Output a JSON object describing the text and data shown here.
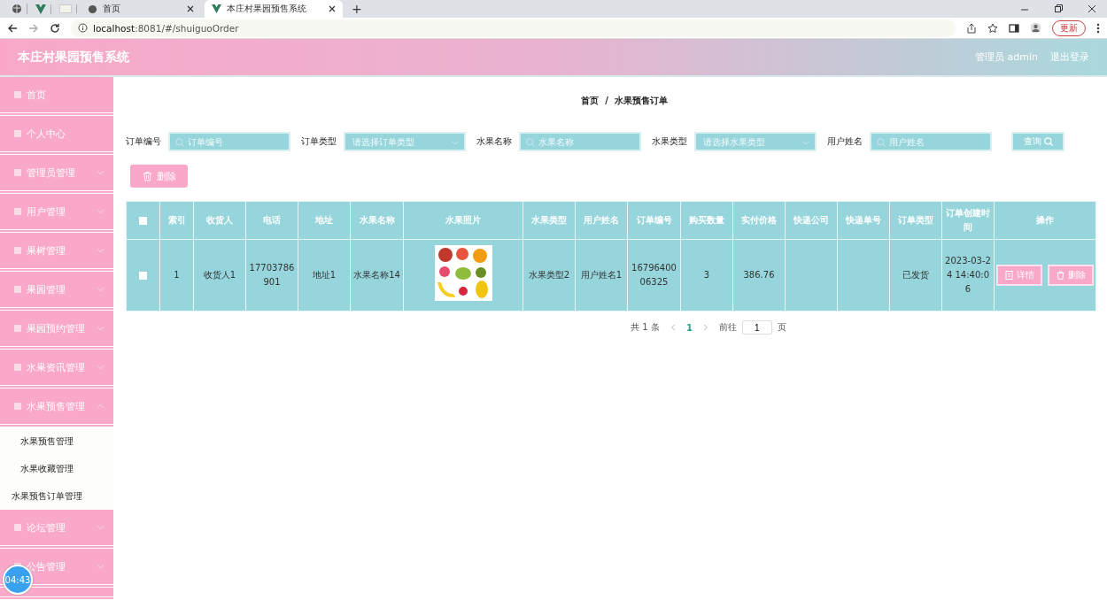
{
  "browser": {
    "tabs": [
      {
        "title": "首页",
        "selected": false
      },
      {
        "title": "本庄村果园预售系统",
        "selected": true
      }
    ],
    "new_tab": "+",
    "url_host": "localhost",
    "url_rest": ":8081/#/shuiguoOrder",
    "update_button": "更新"
  },
  "header": {
    "title": "本庄村果园预售系统",
    "user": "管理员 admin",
    "logout": "退出登录"
  },
  "sidebar": {
    "items": [
      {
        "label": "首页",
        "kind": "link"
      },
      {
        "label": "个人中心",
        "kind": "link"
      },
      {
        "label": "管理员管理",
        "kind": "menu",
        "expanded": false
      },
      {
        "label": "用户管理",
        "kind": "menu",
        "expanded": false
      },
      {
        "label": "果树管理",
        "kind": "menu",
        "expanded": false
      },
      {
        "label": "果园管理",
        "kind": "menu",
        "expanded": false
      },
      {
        "label": "果园预约管理",
        "kind": "menu",
        "expanded": false
      },
      {
        "label": "水果资讯管理",
        "kind": "menu",
        "expanded": false
      },
      {
        "label": "水果预售管理",
        "kind": "menu",
        "expanded": true,
        "children": [
          {
            "label": "水果预售管理",
            "kind": "sub"
          },
          {
            "label": "水果收藏管理",
            "kind": "sub"
          },
          {
            "label": "水果预售订单管理",
            "kind": "flat"
          }
        ]
      },
      {
        "label": "论坛管理",
        "kind": "menu",
        "expanded": false
      },
      {
        "label": "公告管理",
        "kind": "menu",
        "expanded": false
      }
    ]
  },
  "timer": "04:43",
  "breadcrumb": [
    "首页",
    "/",
    "水果预售订单"
  ],
  "filters": [
    {
      "label": "订单编号",
      "placeholder": "订单编号",
      "kind": "input"
    },
    {
      "label": "订单类型",
      "placeholder": "请选择订单类型",
      "kind": "select"
    },
    {
      "label": "水果名称",
      "placeholder": "水果名称",
      "kind": "input"
    },
    {
      "label": "水果类型",
      "placeholder": "请选择水果类型",
      "kind": "select"
    },
    {
      "label": "用户姓名",
      "placeholder": "用户姓名",
      "kind": "input"
    }
  ],
  "search_button": "查询",
  "delete_button": "删除",
  "table": {
    "select_all_checked": false,
    "columns": [
      "索引",
      "收货人",
      "电话",
      "地址",
      "水果名称",
      "水果照片",
      "水果类型",
      "用户姓名",
      "订单编号",
      "购买数量",
      "实付价格",
      "快递公司",
      "快递单号",
      "订单类型",
      "订单创建时间",
      "操作"
    ],
    "rows": [
      {
        "checked": false,
        "cells": [
          "1",
          "收货人1",
          "17703786901",
          "地址1",
          "水果名称14",
          {
            "kind": "picture"
          },
          "水果类型2",
          "用户姓名1",
          "1679640006325",
          "3",
          "386.76",
          "",
          "",
          "已发货",
          "2023-03-24 14:40:06"
        ],
        "actions": [
          "详情",
          "删除"
        ]
      }
    ]
  },
  "pagination": {
    "total": "共 1 条",
    "pages": [
      {
        "label": "1",
        "selected": true
      }
    ],
    "goto": "前往",
    "page_input": "1",
    "page_unit": "页"
  }
}
